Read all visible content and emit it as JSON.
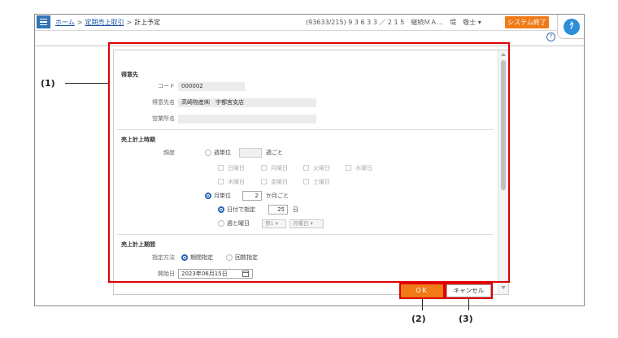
{
  "breadcrumb": {
    "home": "ホーム",
    "sep1": ">",
    "parent": "定期売上取引",
    "sep2": ">",
    "current": "計上予定"
  },
  "header": {
    "user_info": "(93633/215) 9 3 6 3 3 ／ 2 1 5　継続ＭＡ…　堤　敬士 ▾",
    "system_end": "システム終了",
    "help": "?",
    "avatar": "ｸ"
  },
  "customer": {
    "section": "得意先",
    "code_label": "コード",
    "code_value": "000002",
    "name_label": "得意先名",
    "name_value": "高崎物産㈱　宇都宮支店",
    "office_label": "営業所名",
    "office_value": ""
  },
  "timing": {
    "section": "売上計上時期",
    "freq_label": "頻度",
    "weekly_label": "週単位",
    "weekly_value": "",
    "weekly_suffix": "週ごと",
    "days_row1": [
      "日曜日",
      "月曜日",
      "火曜日",
      "水曜日"
    ],
    "days_row2": [
      "木曜日",
      "金曜日",
      "土曜日"
    ],
    "monthly_label": "月単位",
    "monthly_value": "2",
    "monthly_suffix": "か月ごと",
    "by_date_label": "日付で指定",
    "by_date_value": "25",
    "by_date_suffix": "日",
    "by_week_label": "週と曜日",
    "week_select": "第1",
    "weekday_select": "月曜日"
  },
  "period": {
    "section": "売上計上期間",
    "method_label": "指定方法",
    "option_period": "期間指定",
    "option_count": "回数指定",
    "start_label": "開始日",
    "start_value": "2023年06月15日"
  },
  "buttons": {
    "ok": "OK",
    "cancel": "キャンセル"
  },
  "callouts": {
    "c1": "(1)",
    "c2": "(2)",
    "c3": "(3)"
  },
  "colors": {
    "accent": "#f07a18",
    "highlight": "#e00000",
    "link": "#1a55a8",
    "radio_selected": "#2563b5"
  }
}
